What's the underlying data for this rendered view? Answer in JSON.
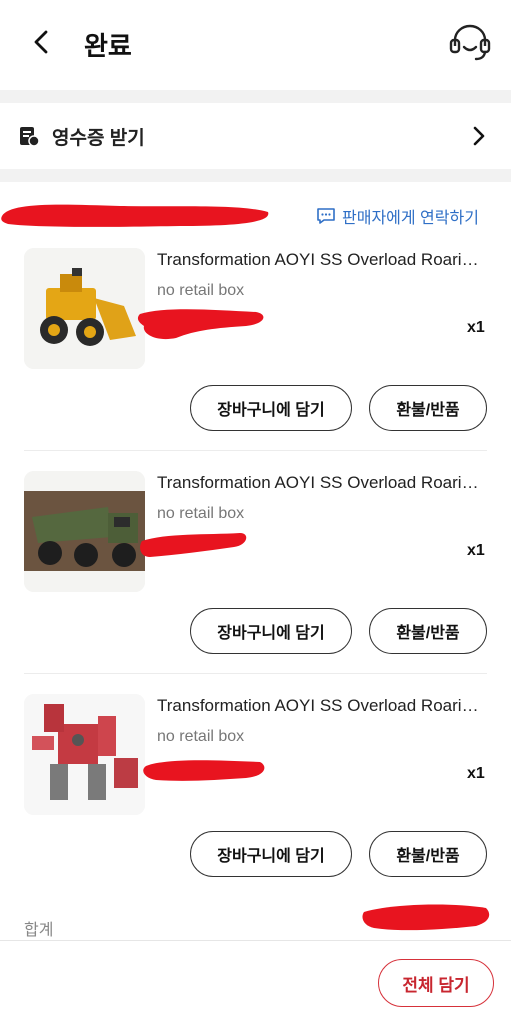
{
  "header": {
    "title": "완료",
    "back_icon": "back-arrow-icon",
    "support_icon": "headset-icon"
  },
  "receipt": {
    "label": "영수증 받기",
    "icon": "receipt-icon",
    "chevron": "chevron-right-icon"
  },
  "order": {
    "contact_seller": "판매자에게 연락하기",
    "items": [
      {
        "name": "Transformation AOYI SS Overload Roaring Tiger",
        "option": "no retail box",
        "qty": "x1",
        "thumbnail": "yellow-loader-robot-image"
      },
      {
        "name": "Transformation AOYI SS Overload Roaring Tiger",
        "option": "no retail box",
        "qty": "x1",
        "thumbnail": "green-dump-truck-image"
      },
      {
        "name": "Transformation AOYI SS Overload Roaring Tiger",
        "option": "no retail box",
        "qty": "x1",
        "thumbnail": "red-robot-image"
      }
    ],
    "add_to_cart_label": "장바구니에 담기",
    "refund_label": "환불/반품",
    "total_label": "합계"
  },
  "bottom": {
    "add_all_label": "전체 담기"
  },
  "colors": {
    "accent": "#d6313a",
    "link": "#2f6fc6",
    "redaction": "#e8141f"
  }
}
